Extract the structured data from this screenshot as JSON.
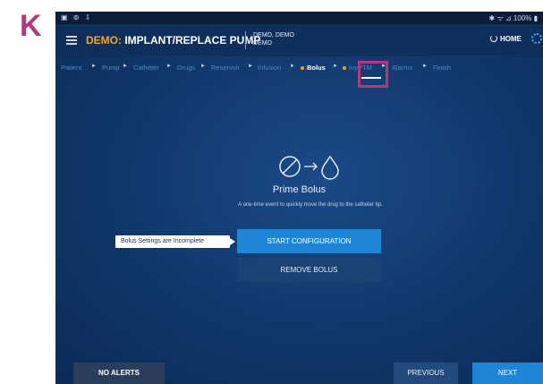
{
  "panel_letter": "K",
  "colors": {
    "accent_magenta": "#b2397e",
    "demo_orange": "#f5a623",
    "primary_blue": "#1f86d6",
    "step_blue": "#4a89c8"
  },
  "status_bar": {
    "left_icons": "▣ ⊚ ⇩",
    "right_text": "✱ ᯤ ⊿ 100% ▮"
  },
  "app_bar": {
    "title_demo": "DEMO:",
    "title_rest": " IMPLANT/REPLACE PUMP",
    "patient_line1": "DEMO, DEMO",
    "patient_line2": "DEMO",
    "home_label": "HOME",
    "menu_icon": "hamburger-icon",
    "home_icon": "power-icon",
    "settings_icon": "gear-icon"
  },
  "steps": [
    {
      "label": "Patient"
    },
    {
      "label": "Pump"
    },
    {
      "label": "Catheter"
    },
    {
      "label": "Drugs"
    },
    {
      "label": "Reservoir"
    },
    {
      "label": "Infusion"
    },
    {
      "label": "Bolus",
      "active": true,
      "attention": true
    },
    {
      "label": "myPTM",
      "attention": true
    },
    {
      "label": "Alarms"
    },
    {
      "label": "Finish"
    }
  ],
  "step_separator": "►",
  "main": {
    "title": "Prime Bolus",
    "description": "A one-time event to quickly move the drug to the catheter tip.",
    "tooltip": "Bolus Settings are Incomplete",
    "start_label": "START CONFIGURATION",
    "remove_label": "REMOVE BOLUS"
  },
  "bottom": {
    "alerts_label": "NO ALERTS",
    "previous_label": "PREVIOUS",
    "next_label": "NEXT"
  }
}
